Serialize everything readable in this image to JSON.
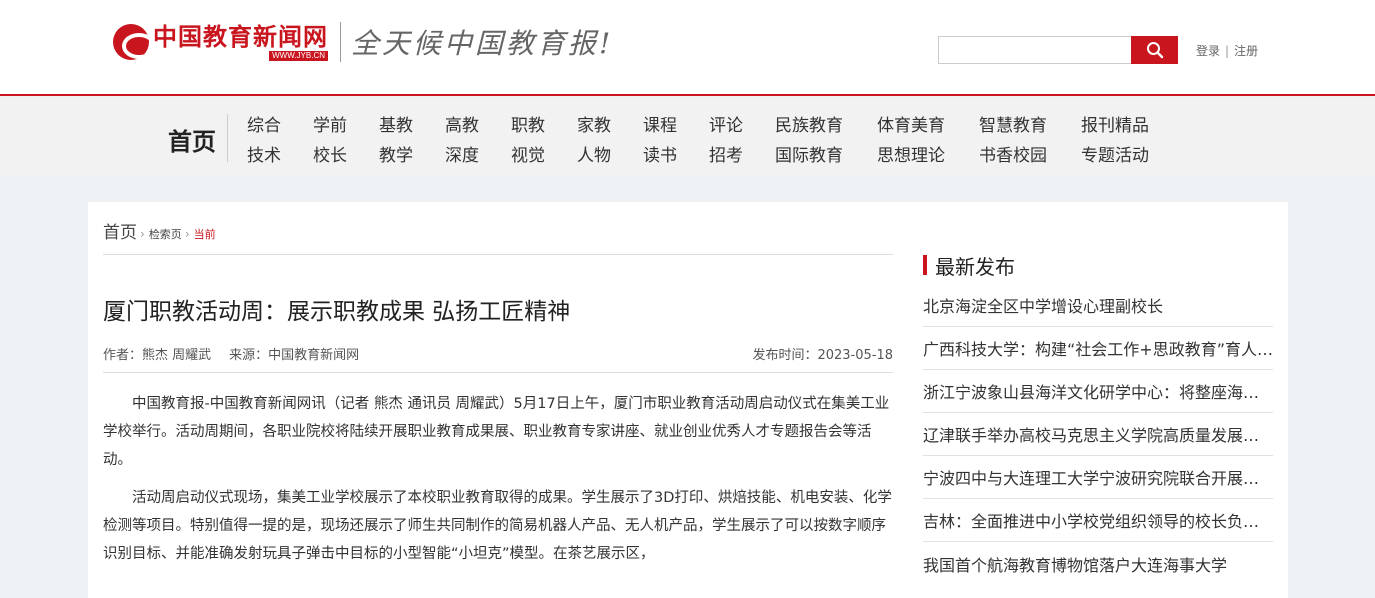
{
  "header": {
    "logo_text": "中国教育新闻网",
    "logo_url": "WWW.JYB.CN",
    "slogan": "全天候中国教育报!",
    "search_placeholder": "",
    "login": "登录",
    "register": "注册",
    "accent_color": "#c9151e"
  },
  "nav": {
    "home": "首页",
    "row1": [
      "综合",
      "学前",
      "基教",
      "高教",
      "职教",
      "家教",
      "课程",
      "评论",
      "民族教育",
      "体育美育",
      "智慧教育",
      "报刊精品"
    ],
    "row2": [
      "技术",
      "校长",
      "教学",
      "深度",
      "视觉",
      "人物",
      "读书",
      "招考",
      "国际教育",
      "思想理论",
      "书香校园",
      "专题活动"
    ]
  },
  "breadcrumb": {
    "home": "首页",
    "search": "检索页",
    "current": "当前"
  },
  "article": {
    "title": "厦门职教活动周：展示职教成果 弘扬工匠精神",
    "author": "作者：熊杰 周耀武",
    "source": "来源：中国教育新闻网",
    "date": "发布时间：2023-05-18",
    "paragraphs": [
      "中国教育报-中国教育新闻网讯（记者 熊杰 通讯员 周耀武）5月17日上午，厦门市职业教育活动周启动仪式在集美工业学校举行。活动周期间，各职业院校将陆续开展职业教育成果展、职业教育专家讲座、就业创业优秀人才专题报告会等活动。",
      "活动周启动仪式现场，集美工业学校展示了本校职业教育取得的成果。学生展示了3D打印、烘焙技能、机电安装、化学检测等项目。特别值得一提的是，现场还展示了师生共同制作的简易机器人产品、无人机产品，学生展示了可以按数字顺序识别目标、并能准确发射玩具子弹击中目标的小型智能“小坦克”模型。在茶艺展示区，"
    ]
  },
  "sidebar": {
    "title": "最新发布",
    "items": [
      "北京海淀全区中学增设心理副校长",
      "广西科技大学：构建“社会工作+思政教育”育人新模式",
      "浙江宁波象山县海洋文化研学中心：将整座海岛变成研学课堂",
      "辽津联手举办高校马克思主义学院高质量发展合作论坛",
      "宁波四中与大连理工大学宁波研究院联合开展科创教育",
      "吉林：全面推进中小学校党组织领导的校长负责制",
      "我国首个航海教育博物馆落户大连海事大学"
    ]
  }
}
